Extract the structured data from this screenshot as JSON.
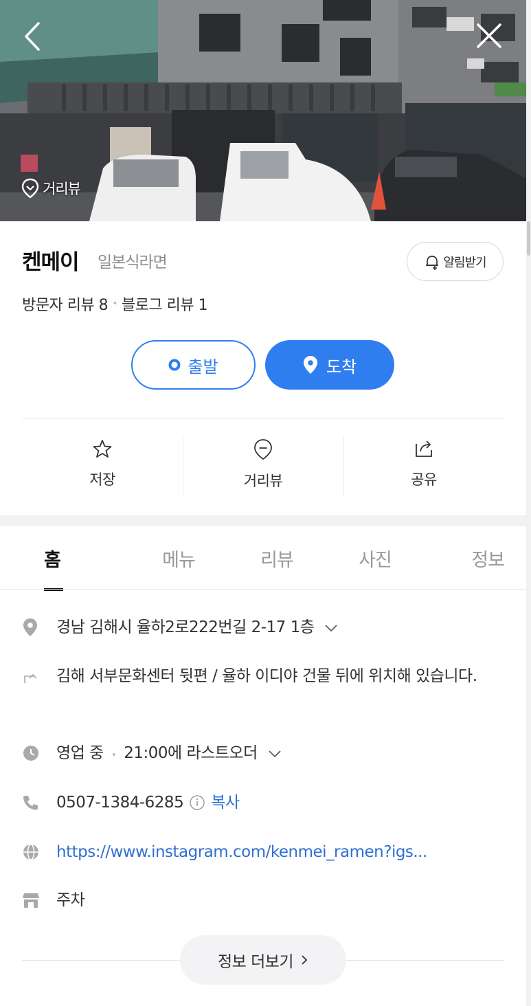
{
  "hero": {
    "streetview_label": "거리뷰"
  },
  "place": {
    "name": "켄메이",
    "category": "일본식라면",
    "alarm_label": "알림받기",
    "visitor_reviews": "방문자 리뷰 8",
    "blog_reviews": "블로그 리뷰 1"
  },
  "route": {
    "start_label": "출발",
    "end_label": "도착"
  },
  "actions": [
    {
      "label": "저장",
      "icon": "star-icon"
    },
    {
      "label": "거리뷰",
      "icon": "streetview-icon"
    },
    {
      "label": "공유",
      "icon": "share-icon"
    }
  ],
  "tabs": [
    {
      "label": "홈",
      "active": true
    },
    {
      "label": "메뉴",
      "active": false
    },
    {
      "label": "리뷰",
      "active": false
    },
    {
      "label": "사진",
      "active": false
    },
    {
      "label": "정보",
      "active": false
    }
  ],
  "info": {
    "address": "경남 김해시 율하2로222번길 2-17 1층",
    "directions": "김해 서부문화센터 뒷편 / 율하 이디야 건물 뒤에 위치해 있습니다.",
    "hours_status": "영업 중",
    "hours_detail": "21:00에 라스트오더",
    "phone": "0507-1384-6285",
    "copy_label": "복사",
    "website": "https://www.instagram.com/kenmei_ramen?igs...",
    "parking": "주차"
  },
  "more_label": "정보 더보기",
  "colors": {
    "accent": "#2f7ef0",
    "link": "#2f6fd1",
    "icon_gray": "#a9a9a9"
  }
}
